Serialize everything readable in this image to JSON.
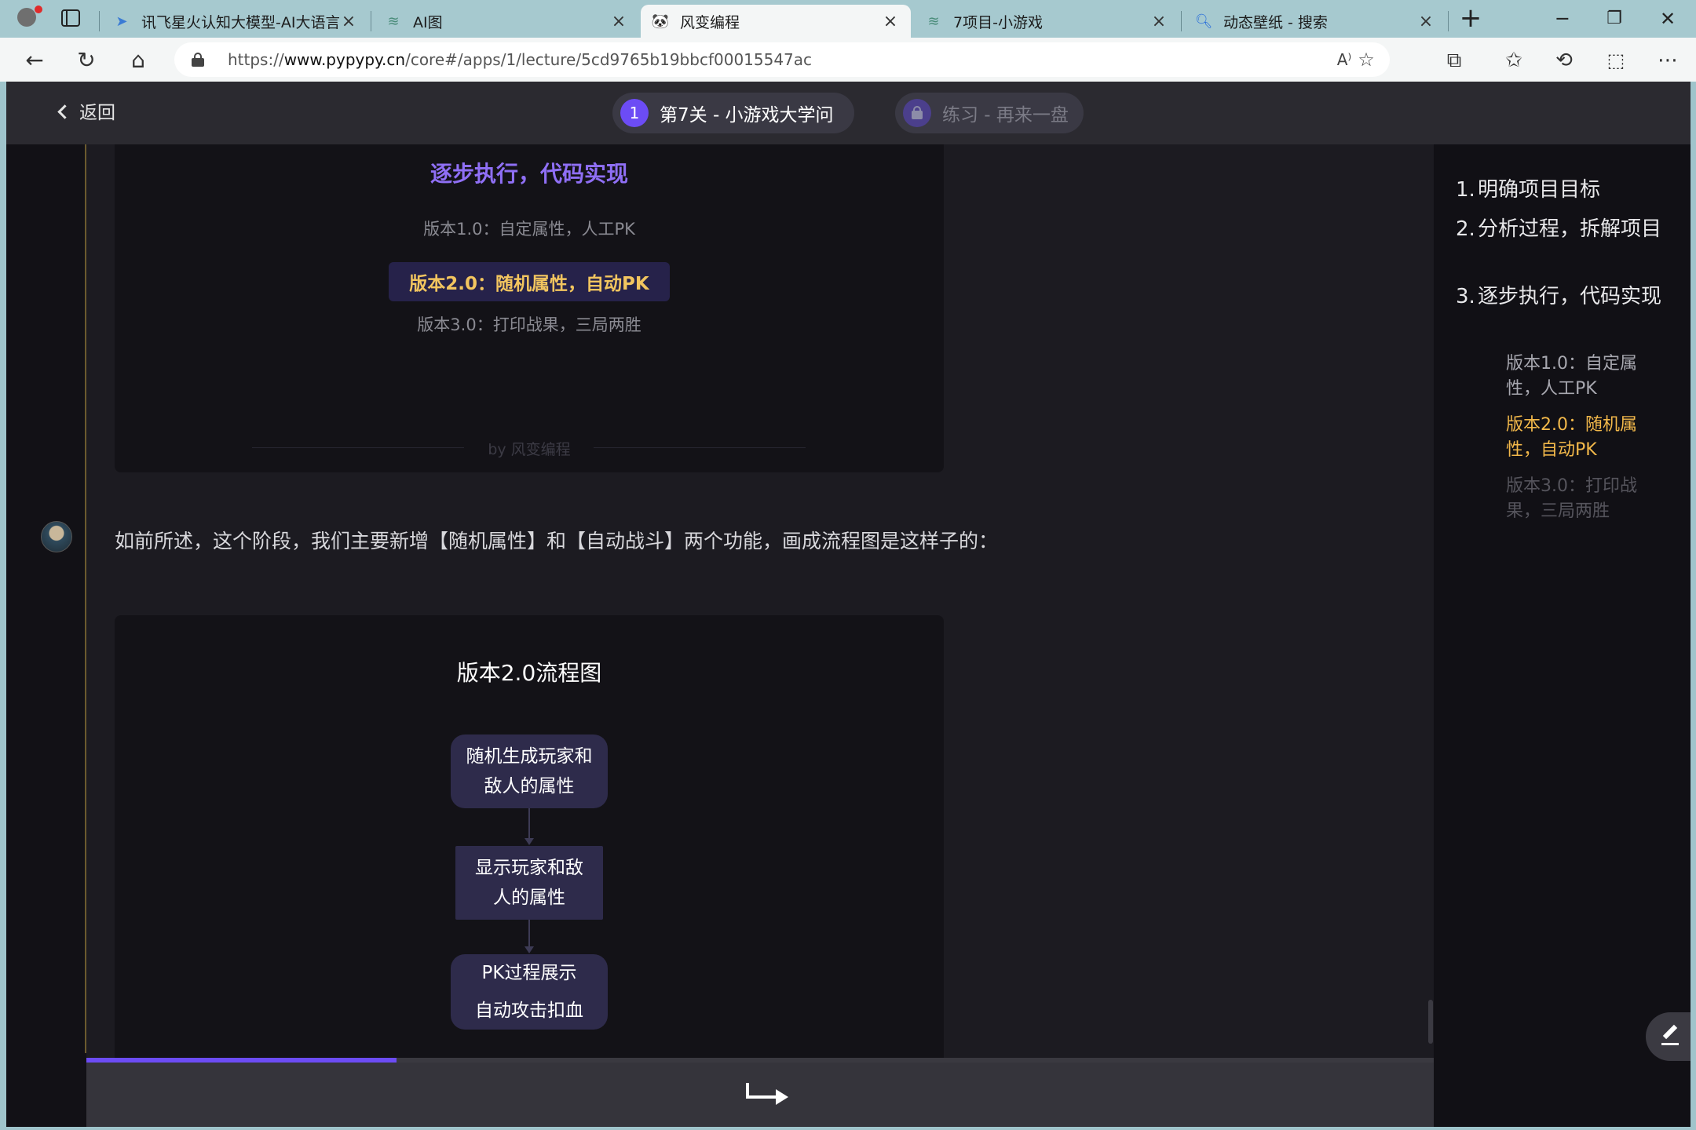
{
  "browser": {
    "tabs": [
      {
        "label": "讯飞星火认知大模型-AI大语言",
        "icon": "spark-favicon",
        "active": false
      },
      {
        "label": "AI图",
        "icon": "pen-favicon",
        "active": false
      },
      {
        "label": "风变编程",
        "icon": "panda-favicon",
        "active": true
      },
      {
        "label": "7项目-小游戏",
        "icon": "pen-favicon",
        "active": false
      },
      {
        "label": "动态壁纸 - 搜索",
        "icon": "search-favicon",
        "active": false
      }
    ],
    "url": "https://www.pypypy.cn/core#/apps/1/lecture/5cd9765b19bbcf00015547ac",
    "url_display": {
      "prefix": "https://",
      "domain": "www.pypypy.cn",
      "path": "/core#/apps/1/lecture/5cd9765b19bbcf00015547ac"
    }
  },
  "header": {
    "back_label": "返回",
    "level_number": "1",
    "level_title": "第7关 - 小游戏大学问",
    "practice_title": "练习 - 再来一盘",
    "accent_color": "#6c4cf5"
  },
  "card1": {
    "title": "逐步执行，代码实现",
    "versions": [
      "版本1.0：自定属性，人工PK",
      "版本2.0：随机属性，自动PK",
      "版本3.0：打印战果，三局两胜"
    ],
    "signature": "by 风变编程"
  },
  "message": {
    "text": "如前所述，这个阶段，我们主要新增【随机属性】和【自动战斗】两个功能，画成流程图是这样子的："
  },
  "flowchart": {
    "title": "版本2.0流程图",
    "nodes": [
      {
        "line1": "随机生成玩家和",
        "line2": "敌人的属性"
      },
      {
        "line1": "显示玩家和敌",
        "line2": "人的属性"
      },
      {
        "line1": "PK过程展示",
        "line2": "自动攻击扣血"
      }
    ]
  },
  "toc": {
    "items": [
      {
        "num": "1.",
        "label": "明确项目目标"
      },
      {
        "num": "2.",
        "label": "分析过程，拆解项目"
      },
      {
        "num": "3.",
        "label": "逐步执行，代码实现"
      }
    ],
    "subitems": [
      {
        "label": "版本1.0：自定属性，人工PK",
        "state": "normal"
      },
      {
        "label": "版本2.0：随机属性，自动PK",
        "state": "active"
      },
      {
        "label": "版本3.0：打印战果，三局两胜",
        "state": "dim"
      }
    ],
    "active_color": "#f2b84a"
  },
  "progress": {
    "fraction": 0.23
  }
}
